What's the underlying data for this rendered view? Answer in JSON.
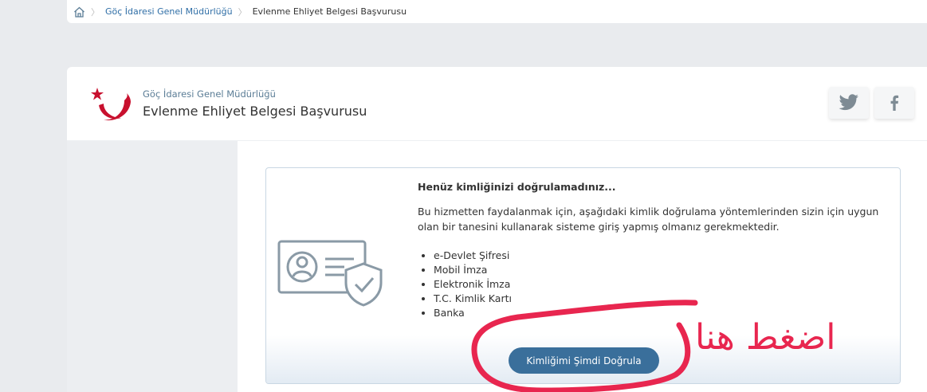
{
  "breadcrumb": {
    "home_icon": "home-icon",
    "items": [
      "Göç İdaresi Genel Müdürlüğü",
      "Evlenme Ehliyet Belgesi Başvurusu"
    ]
  },
  "header": {
    "institution": "Göç İdaresi Genel Müdürlüğü",
    "page_title": "Evlenme Ehliyet Belgesi Başvurusu",
    "share": [
      "twitter-icon",
      "facebook-icon"
    ]
  },
  "verification": {
    "title": "Henüz kimliğinizi doğrulamadınız...",
    "body": "Bu hizmetten faydalanmak için, aşağıdaki kimlik doğrulama yöntemlerinden sizin için uygun olan bir tanesini kullanarak sisteme giriş yapmış olmanız gerekmektedir.",
    "methods": [
      "e-Devlet Şifresi",
      "Mobil İmza",
      "Elektronik İmza",
      "T.C. Kimlik Kartı",
      "Banka"
    ],
    "button_label": "Kimliğimi Şimdi Doğrula"
  },
  "annotation": {
    "text": "اضغط هنا",
    "color": "#e8264f"
  },
  "colors": {
    "accent": "#3a6f9b",
    "logo_red": "#c8102e",
    "link": "#2f6ea6"
  }
}
